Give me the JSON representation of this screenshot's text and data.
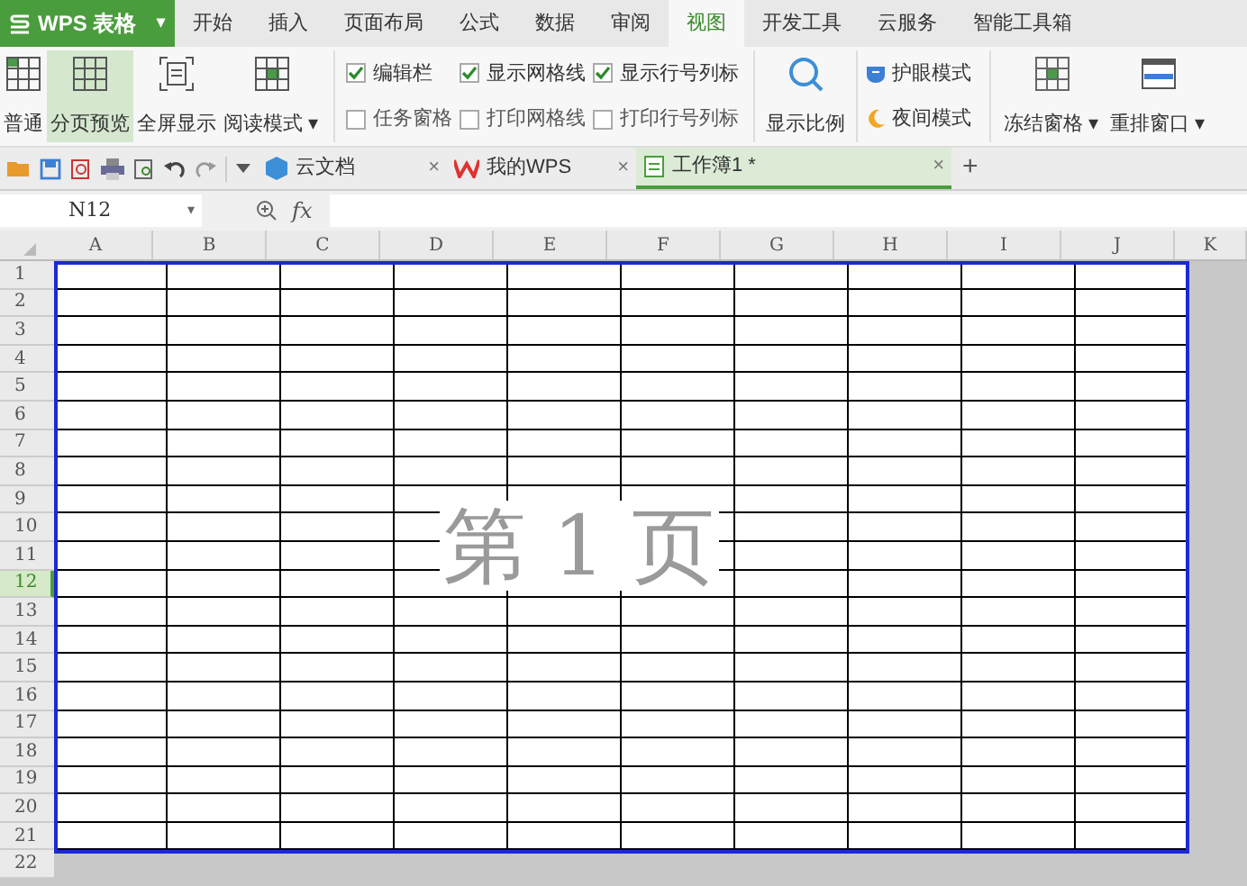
{
  "app_menu": {
    "label": "WPS 表格",
    "caret": "▾"
  },
  "menu_tabs": [
    {
      "label": "开始",
      "selected": false
    },
    {
      "label": "插入",
      "selected": false
    },
    {
      "label": "页面布局",
      "selected": false
    },
    {
      "label": "公式",
      "selected": false
    },
    {
      "label": "数据",
      "selected": false
    },
    {
      "label": "审阅",
      "selected": false
    },
    {
      "label": "视图",
      "selected": true
    },
    {
      "label": "开发工具",
      "selected": false
    },
    {
      "label": "云服务",
      "selected": false
    },
    {
      "label": "智能工具箱",
      "selected": false
    }
  ],
  "view_modes": [
    {
      "label": "普通",
      "selected": false,
      "kind": "normal"
    },
    {
      "label": "分页预览",
      "selected": true,
      "kind": "pagebreak"
    },
    {
      "label": "全屏显示",
      "selected": false,
      "kind": "fullscreen"
    },
    {
      "label": "阅读模式 ▾",
      "selected": false,
      "kind": "reading"
    }
  ],
  "checkbox_columns": [
    [
      {
        "label": "编辑栏",
        "checked": true
      },
      {
        "label": "任务窗格",
        "checked": false
      }
    ],
    [
      {
        "label": "显示网格线",
        "checked": true
      },
      {
        "label": "打印网格线",
        "checked": false
      }
    ],
    [
      {
        "label": "显示行号列标",
        "checked": true
      },
      {
        "label": "打印行号列标",
        "checked": false
      }
    ]
  ],
  "zoom_button": {
    "label": "显示比例"
  },
  "modes": [
    {
      "label": "护眼模式",
      "kind": "eye"
    },
    {
      "label": "夜间模式",
      "kind": "night"
    }
  ],
  "window_buttons": [
    {
      "label": "冻结窗格 ▾",
      "kind": "freeze"
    },
    {
      "label": "重排窗口 ▾",
      "kind": "arrange"
    }
  ],
  "doc_tabs": [
    {
      "label": "云文档",
      "selected": false,
      "kind": "cloud",
      "close": "×"
    },
    {
      "label": "我的WPS",
      "selected": false,
      "kind": "wps",
      "close": "×"
    },
    {
      "label": "工作簿1 *",
      "selected": true,
      "kind": "sheet",
      "close": "×"
    }
  ],
  "new_tab": "+",
  "formula_bar": {
    "cell_ref": "N12",
    "caret": "▾",
    "fx": "fx"
  },
  "columns": [
    "A",
    "B",
    "C",
    "D",
    "E",
    "F",
    "G",
    "H",
    "I",
    "J",
    "K"
  ],
  "rows": [
    {
      "label": "1",
      "selected": false
    },
    {
      "label": "2",
      "selected": false
    },
    {
      "label": "3",
      "selected": false
    },
    {
      "label": "4",
      "selected": false
    },
    {
      "label": "5",
      "selected": false
    },
    {
      "label": "6",
      "selected": false
    },
    {
      "label": "7",
      "selected": false
    },
    {
      "label": "8",
      "selected": false
    },
    {
      "label": "9",
      "selected": false
    },
    {
      "label": "10",
      "selected": false
    },
    {
      "label": "11",
      "selected": false
    },
    {
      "label": "12",
      "selected": true
    },
    {
      "label": "13",
      "selected": false
    },
    {
      "label": "14",
      "selected": false
    },
    {
      "label": "15",
      "selected": false
    },
    {
      "label": "16",
      "selected": false
    },
    {
      "label": "17",
      "selected": false
    },
    {
      "label": "18",
      "selected": false
    },
    {
      "label": "19",
      "selected": false
    },
    {
      "label": "20",
      "selected": false
    },
    {
      "label": "21",
      "selected": false
    },
    {
      "label": "22",
      "selected": false
    }
  ],
  "page_label": "第 1 页"
}
